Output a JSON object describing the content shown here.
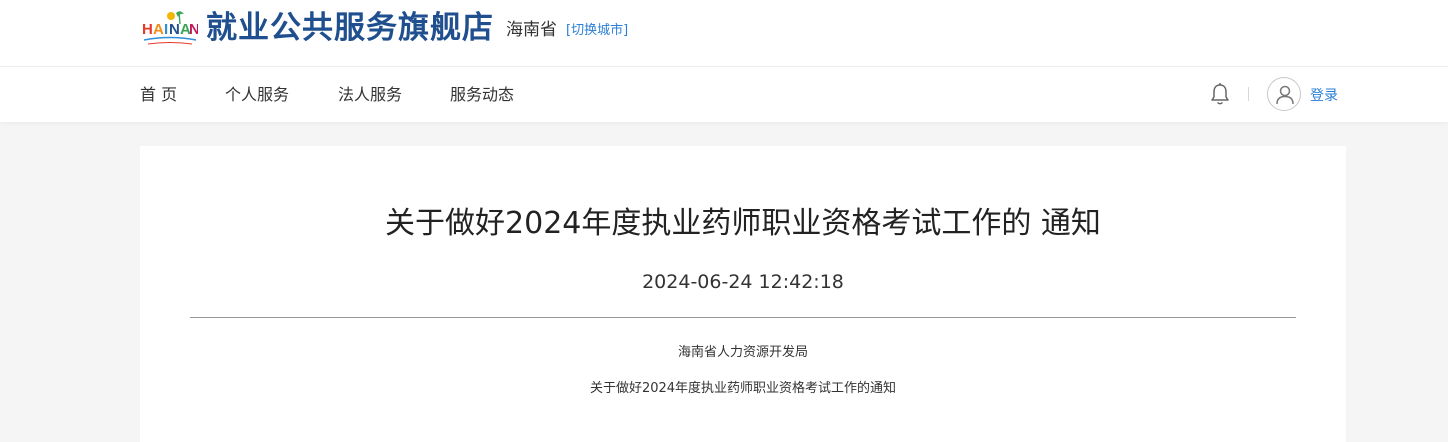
{
  "header": {
    "site_title": "就业公共服务旗舰店",
    "province": "海南省",
    "switch_city": "[切换城市]",
    "logo_icon": "hainan-logo-icon"
  },
  "nav": {
    "items": [
      {
        "label": "首 页"
      },
      {
        "label": "个人服务"
      },
      {
        "label": "法人服务"
      },
      {
        "label": "服务动态"
      }
    ],
    "bell_icon": "bell-icon",
    "avatar_icon": "user-avatar-icon",
    "login_label": "登录"
  },
  "article": {
    "title": "关于做好2024年度执业药师职业资格考试工作的 通知",
    "date": "2024-06-24 12:42:18",
    "source": "海南省人力资源开发局",
    "subtitle": "关于做好2024年度执业药师职业资格考试工作的通知"
  },
  "colors": {
    "brand_blue": "#1f4f8f",
    "link_blue": "#2a7fd6",
    "page_bg": "#f5f5f5"
  }
}
